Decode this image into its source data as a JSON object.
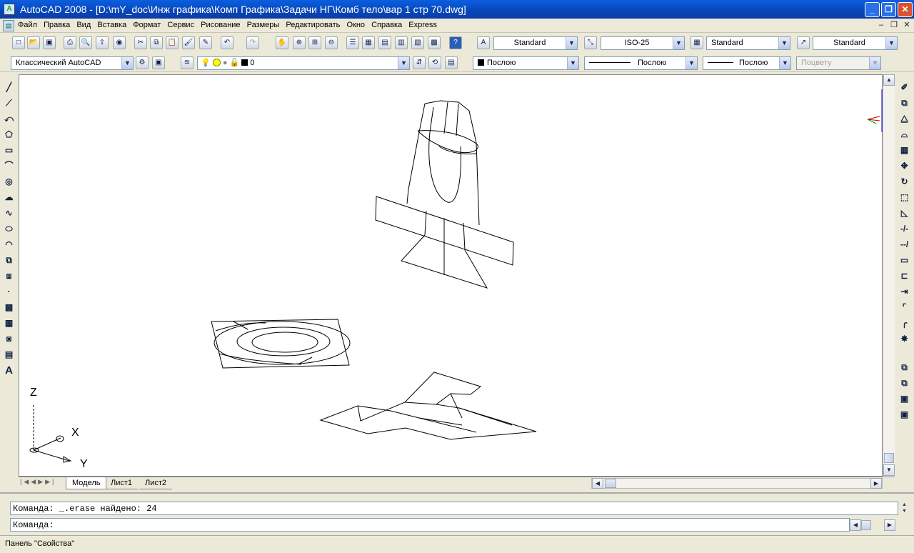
{
  "window": {
    "title": "AutoCAD 2008 - [D:\\mY_doc\\Инж графика\\Комп Графика\\Задачи НГ\\Комб тело\\вар 1 стр 70.dwg]"
  },
  "menu": [
    "Файл",
    "Правка",
    "Вид",
    "Вставка",
    "Формат",
    "Сервис",
    "Рисование",
    "Размеры",
    "Редактировать",
    "Окно",
    "Справка",
    "Express"
  ],
  "styles": {
    "text_style": "Standard",
    "dim_style": "ISO-25",
    "table_style": "Standard",
    "mleader_style": "Standard"
  },
  "workspace": "Классический AutoCAD",
  "layer": {
    "current": "0"
  },
  "properties": {
    "color": "Послою",
    "linetype": "Послою",
    "lineweight": "Послою",
    "plotstyle": "Поцвету"
  },
  "tabs": [
    "Модель",
    "Лист1",
    "Лист2"
  ],
  "ucs": {
    "z": "Z",
    "x": "X",
    "y": "Y"
  },
  "command": {
    "history": "Команда: _.erase найдено: 24",
    "prompt": "Команда:"
  },
  "status": {
    "text": "Панель \"Свойства\""
  },
  "colors": {
    "title_bar": "#0a46b8",
    "canvas": "#ffffff",
    "chrome": "#ece9d8"
  }
}
